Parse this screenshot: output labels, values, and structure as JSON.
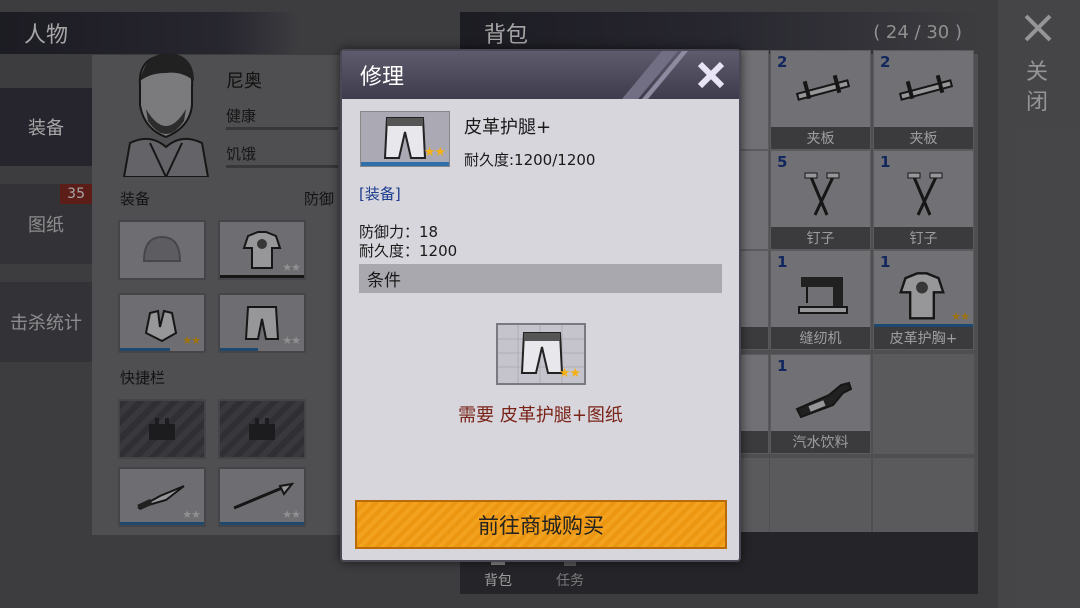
{
  "character_panel": {
    "title": "人物",
    "name": "尼奥",
    "stats": [
      "健康",
      "饥饿"
    ],
    "equipment_label": "装备",
    "defense_label": "防御",
    "quickbar_label": "快捷栏"
  },
  "side_tabs": [
    {
      "label": "装备",
      "active": true
    },
    {
      "label": "图纸",
      "badge": "35"
    },
    {
      "label": "击杀统计"
    }
  ],
  "backpack": {
    "title": "背包",
    "capacity": "( 24 / 30 )",
    "items": [
      {
        "count": "2",
        "name": "夹板",
        "icon": "splint-icon"
      },
      {
        "count": "2",
        "name": "夹板",
        "icon": "splint-icon"
      },
      {
        "count": "5",
        "name": "钉子",
        "icon": "nails-icon"
      },
      {
        "count": "1",
        "name": "钉子",
        "icon": "nails-icon"
      },
      {
        "count": "1",
        "name": "缝纫机",
        "icon": "sewing-machine-icon"
      },
      {
        "count": "1",
        "name": "皮革护胸+",
        "icon": "leather-chest-icon",
        "stars": 2
      },
      {
        "count": "1",
        "name": "汽水饮料",
        "icon": "soda-bottle-icon"
      }
    ],
    "partial_names": [
      "革",
      "料"
    ],
    "bottom_tabs": [
      "背包",
      "任务"
    ]
  },
  "close_label": "关闭",
  "repair_modal": {
    "title": "修理",
    "item_name": "皮革护腿+",
    "durability_line": "耐久度:1200/1200",
    "type_tag": "[装备]",
    "defense_line": "防御力：18",
    "durability_stat": "耐久度：1200",
    "condition_label": "条件",
    "need_text": "需要 皮革护腿+图纸",
    "buy_button": "前往商城购买",
    "stars": 2
  },
  "colors": {
    "accent_orange": "#f2a21e",
    "need_text": "#7a2317",
    "count_blue": "#1d3d8f",
    "durability_bar": "#2f6fa9"
  }
}
